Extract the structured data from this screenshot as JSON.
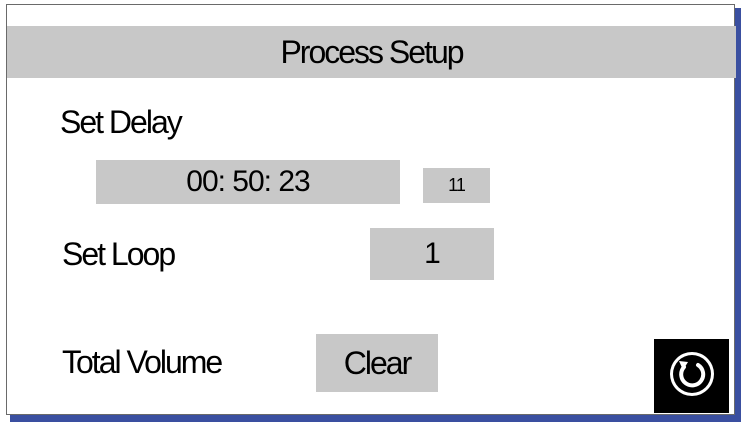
{
  "header": {
    "title": "Process Setup"
  },
  "delay": {
    "label": "Set Delay",
    "time_value": "00:  50:  23",
    "seconds_value": "11"
  },
  "loop": {
    "label": "Set Loop",
    "value": "1"
  },
  "volume": {
    "label": "Total Volume",
    "clear_label": "Clear"
  },
  "icons": {
    "back": "return-arrow-icon"
  },
  "colors": {
    "field_bg": "#c8c8c8",
    "frame_shadow": "#3a4fa0",
    "back_button_bg": "#000000"
  }
}
